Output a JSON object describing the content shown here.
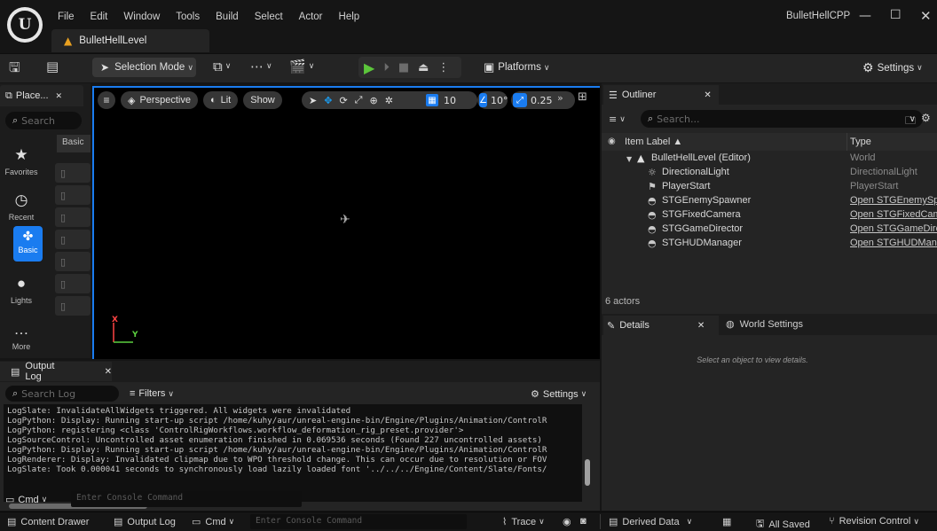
{
  "window": {
    "project_name": "BulletHellCPP",
    "level_tab": "BulletHellLevel",
    "controls": {
      "minimize": "—",
      "maximize": "☐",
      "close": "✕"
    }
  },
  "menu": [
    "File",
    "Edit",
    "Window",
    "Tools",
    "Build",
    "Select",
    "Actor",
    "Help"
  ],
  "toolbar": {
    "selection_mode": "Selection Mode",
    "platforms": "Platforms",
    "settings": "Settings"
  },
  "place_actors": {
    "tab_title": "Place...",
    "search_placeholder": "Search",
    "basic_header": "Basic",
    "categories": [
      {
        "label": "Favorites",
        "icon": "star-icon"
      },
      {
        "label": "Recent",
        "icon": "clock-icon"
      },
      {
        "label": "Basic",
        "icon": "shapes-icon"
      },
      {
        "label": "Lights",
        "icon": "bulb-icon"
      },
      {
        "label": "More",
        "icon": "ellipsis-icon"
      }
    ]
  },
  "viewport": {
    "perspective": "Perspective",
    "lit": "Lit",
    "show": "Show",
    "grid_snap": "10",
    "rotation_snap": "10°",
    "scale_snap": "0.25",
    "axis_x": "X",
    "axis_y": "Y"
  },
  "output_log": {
    "tab_title": "Output Log",
    "search_placeholder": "Search Log",
    "filters": "Filters",
    "settings": "Settings",
    "lines": [
      "LogSlate: InvalidateAllWidgets triggered.  All widgets were invalidated",
      "LogPython: Display: Running start-up script /home/kuhy/aur/unreal-engine-bin/Engine/Plugins/Animation/ControlR",
      "LogPython: registering <class 'ControlRigWorkflows.workflow_deformation_rig_preset.provider'>",
      "LogSourceControl: Uncontrolled asset enumeration finished in 0.069536 seconds (Found 227 uncontrolled assets)",
      "LogPython: Display: Running start-up script /home/kuhy/aur/unreal-engine-bin/Engine/Plugins/Animation/ControlR",
      "LogRenderer: Display: Invalidated clipmap due to WPO threshold change. This can occur due to resolution or FOV",
      "LogSlate: Took 0.000041 seconds to synchronously load lazily loaded font '../../../Engine/Content/Slate/Fonts/"
    ],
    "cmd_label": "Cmd",
    "cmd_placeholder": "Enter Console Command"
  },
  "outliner": {
    "tab_title": "Outliner",
    "search_placeholder": "Search...",
    "col_label": "Item Label ▲",
    "col_type": "Type",
    "rows": [
      {
        "label": "BulletHellLevel (Editor)",
        "type": "World",
        "icon": "level-icon",
        "link": false,
        "indent": 0
      },
      {
        "label": "DirectionalLight",
        "type": "DirectionalLight",
        "icon": "sun-icon",
        "link": false,
        "indent": 1
      },
      {
        "label": "PlayerStart",
        "type": "PlayerStart",
        "icon": "flag-icon",
        "link": false,
        "indent": 1
      },
      {
        "label": "STGEnemySpawner",
        "type": "Open STGEnemySp",
        "icon": "actor-icon",
        "link": true,
        "indent": 1
      },
      {
        "label": "STGFixedCamera",
        "type": "Open STGFixedCam",
        "icon": "actor-icon",
        "link": true,
        "indent": 1
      },
      {
        "label": "STGGameDirector",
        "type": "Open STGGameDire",
        "icon": "actor-icon",
        "link": true,
        "indent": 1
      },
      {
        "label": "STGHUDManager",
        "type": "Open STGHUDMana",
        "icon": "actor-icon",
        "link": true,
        "indent": 1
      }
    ],
    "count": "6 actors"
  },
  "details": {
    "tab_title": "Details",
    "world_settings": "World Settings",
    "empty_message": "Select an object to view details."
  },
  "statusbar": {
    "content_drawer": "Content Drawer",
    "output_log": "Output Log",
    "cmd": "Cmd",
    "cmd_placeholder": "Enter Console Command",
    "trace": "Trace",
    "derived_data": "Derived Data",
    "all_saved": "All Saved",
    "revision_control": "Revision Control"
  },
  "colors": {
    "accent": "#1a7cf0",
    "play": "#5cc63b",
    "level_icon": "#e8a020"
  }
}
